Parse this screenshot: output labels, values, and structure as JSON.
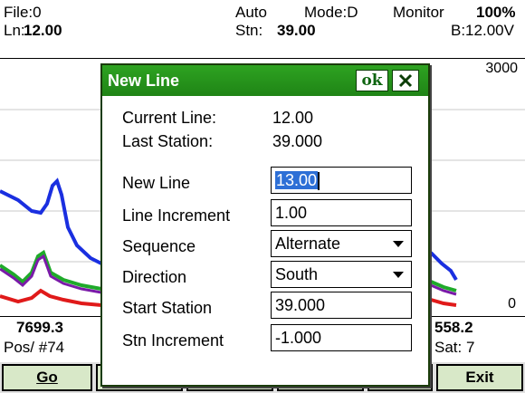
{
  "header": {
    "file": "File:0",
    "mode_auto": "Auto",
    "mode": "Mode:D",
    "monitor": "Monitor",
    "battery_pct": "100%",
    "line_label": "Ln:",
    "line_value": "12.00",
    "station_label": "Stn:",
    "station_value": "39.00",
    "battery_voltage": "B:12.00V"
  },
  "graph": {
    "y_max_label": "3000",
    "y_min_label": "0",
    "trace_colors": [
      "#1a2fe0",
      "#7a1aa8",
      "#1faa2a",
      "#e01a1a"
    ]
  },
  "status": {
    "left_value": "7699.3",
    "pos": "Pos/ #74",
    "right_value": "558.2",
    "sat": "Sat: 7"
  },
  "softkeys": {
    "go": "Go",
    "exit": "Exit"
  },
  "dialog": {
    "title": "New Line",
    "ok": "ok",
    "current_line_label": "Current Line:",
    "current_line_value": "12.00",
    "last_station_label": "Last Station:",
    "last_station_value": "39.000",
    "new_line_label": "New Line",
    "new_line_value": "13.00",
    "line_increment_label": "Line Increment",
    "line_increment_value": "1.00",
    "sequence_label": "Sequence",
    "sequence_value": "Alternate",
    "direction_label": "Direction",
    "direction_value": "South",
    "start_station_label": "Start Station",
    "start_station_value": "39.000",
    "stn_increment_label": "Stn Increment",
    "stn_increment_value": "-1.000"
  }
}
